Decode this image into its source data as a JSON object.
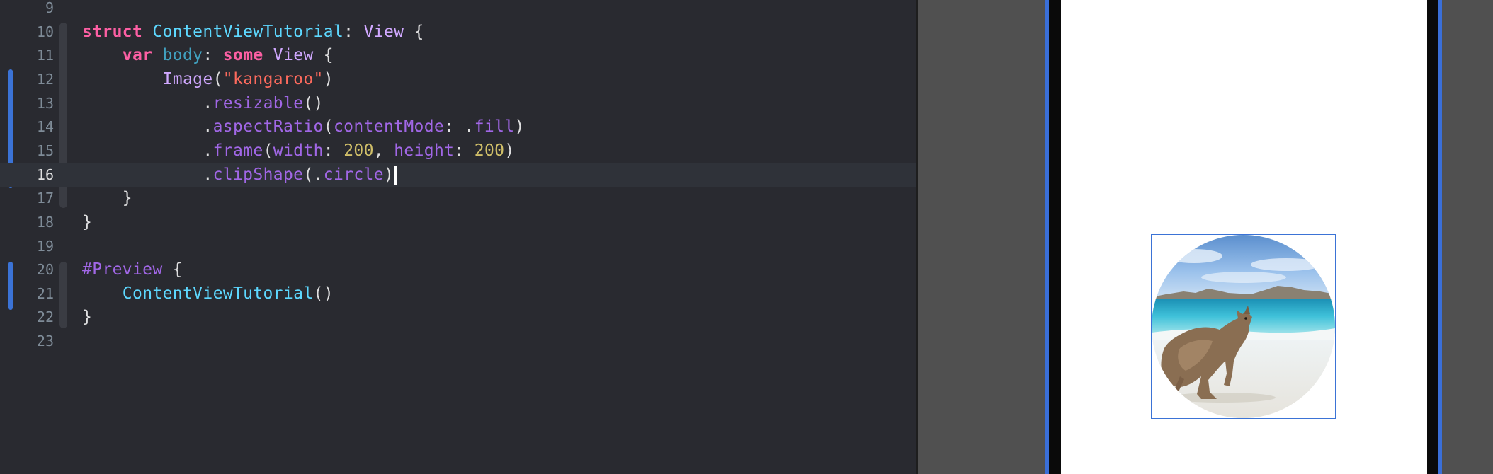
{
  "editor": {
    "lines": [
      {
        "number": "9",
        "tokens": []
      },
      {
        "number": "10",
        "tokens": [
          {
            "cls": "kw",
            "text": "struct"
          },
          {
            "cls": "plain",
            "text": " "
          },
          {
            "cls": "type",
            "text": "ContentViewTutorial"
          },
          {
            "cls": "plain",
            "text": ": "
          },
          {
            "cls": "sysType",
            "text": "View"
          },
          {
            "cls": "plain",
            "text": " {"
          }
        ]
      },
      {
        "number": "11",
        "tokens": [
          {
            "cls": "plain",
            "text": "    "
          },
          {
            "cls": "kw",
            "text": "var"
          },
          {
            "cls": "plain",
            "text": " "
          },
          {
            "cls": "prop",
            "text": "body"
          },
          {
            "cls": "plain",
            "text": ": "
          },
          {
            "cls": "kw",
            "text": "some"
          },
          {
            "cls": "plain",
            "text": " "
          },
          {
            "cls": "sysType",
            "text": "View"
          },
          {
            "cls": "plain",
            "text": " {"
          }
        ]
      },
      {
        "number": "12",
        "tokens": [
          {
            "cls": "plain",
            "text": "        "
          },
          {
            "cls": "sysType",
            "text": "Image"
          },
          {
            "cls": "plain",
            "text": "("
          },
          {
            "cls": "str",
            "text": "\"kangaroo\""
          },
          {
            "cls": "plain",
            "text": ")"
          }
        ]
      },
      {
        "number": "13",
        "tokens": [
          {
            "cls": "plain",
            "text": "            ."
          },
          {
            "cls": "sysFunc",
            "text": "resizable"
          },
          {
            "cls": "plain",
            "text": "()"
          }
        ]
      },
      {
        "number": "14",
        "tokens": [
          {
            "cls": "plain",
            "text": "            ."
          },
          {
            "cls": "sysFunc",
            "text": "aspectRatio"
          },
          {
            "cls": "plain",
            "text": "("
          },
          {
            "cls": "sysFunc",
            "text": "contentMode"
          },
          {
            "cls": "plain",
            "text": ": ."
          },
          {
            "cls": "sysFunc",
            "text": "fill"
          },
          {
            "cls": "plain",
            "text": ")"
          }
        ]
      },
      {
        "number": "15",
        "tokens": [
          {
            "cls": "plain",
            "text": "            ."
          },
          {
            "cls": "sysFunc",
            "text": "frame"
          },
          {
            "cls": "plain",
            "text": "("
          },
          {
            "cls": "sysFunc",
            "text": "width"
          },
          {
            "cls": "plain",
            "text": ": "
          },
          {
            "cls": "num",
            "text": "200"
          },
          {
            "cls": "plain",
            "text": ", "
          },
          {
            "cls": "sysFunc",
            "text": "height"
          },
          {
            "cls": "plain",
            "text": ": "
          },
          {
            "cls": "num",
            "text": "200"
          },
          {
            "cls": "plain",
            "text": ")"
          }
        ]
      },
      {
        "number": "16",
        "current": true,
        "tokens": [
          {
            "cls": "plain",
            "text": "            ."
          },
          {
            "cls": "sysFunc",
            "text": "clipShape"
          },
          {
            "cls": "plain",
            "text": "(."
          },
          {
            "cls": "sysFunc",
            "text": "circle"
          },
          {
            "cls": "plain",
            "text": ")"
          }
        ]
      },
      {
        "number": "17",
        "tokens": [
          {
            "cls": "plain",
            "text": "    }"
          }
        ]
      },
      {
        "number": "18",
        "tokens": [
          {
            "cls": "plain",
            "text": "}"
          }
        ]
      },
      {
        "number": "19",
        "tokens": []
      },
      {
        "number": "20",
        "tokens": [
          {
            "cls": "macro",
            "text": "#Preview"
          },
          {
            "cls": "plain",
            "text": " {"
          }
        ]
      },
      {
        "number": "21",
        "tokens": [
          {
            "cls": "plain",
            "text": "    "
          },
          {
            "cls": "type",
            "text": "ContentViewTutorial"
          },
          {
            "cls": "plain",
            "text": "()"
          }
        ]
      },
      {
        "number": "22",
        "tokens": [
          {
            "cls": "plain",
            "text": "}"
          }
        ]
      },
      {
        "number": "23",
        "tokens": []
      }
    ]
  },
  "preview": {
    "image_name": "kangaroo-photo"
  },
  "colors": {
    "editor_background": "#292a30",
    "current_line": "#2f3239",
    "keyword": "#fc5fa3",
    "type": "#5dd8ff",
    "system_type": "#d0a8ff",
    "system_function": "#a167e6",
    "string": "#fc6a5d",
    "number": "#d0bf69",
    "selection_accent": "#3b73d6",
    "preview_canvas": "#505050"
  }
}
